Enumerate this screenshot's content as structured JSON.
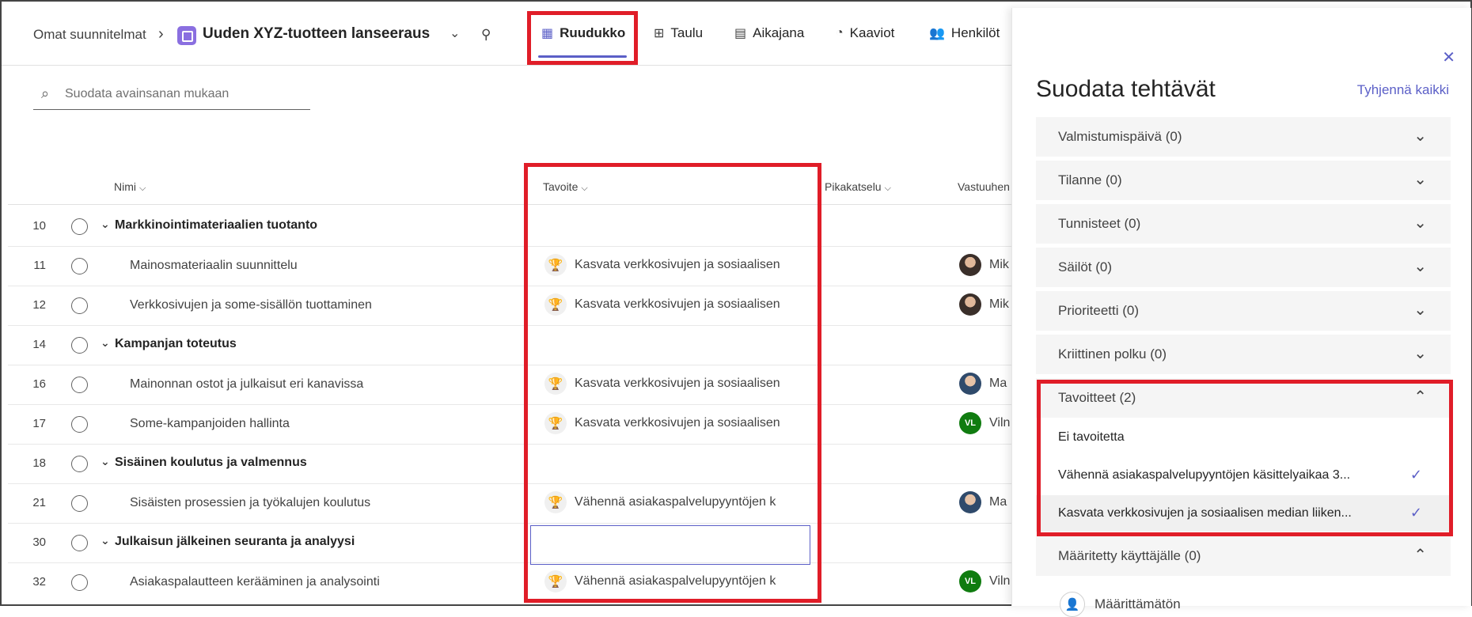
{
  "header": {
    "breadcrumb_root": "Omat suunnitelmat",
    "plan_title": "Uuden XYZ-tuotteen lanseeraus",
    "tabs": [
      {
        "label": "Ruudukko",
        "icon": "grid-icon"
      },
      {
        "label": "Taulu",
        "icon": "board-icon"
      },
      {
        "label": "Aikajana",
        "icon": "timeline-icon"
      },
      {
        "label": "Kaaviot",
        "icon": "charts-icon"
      },
      {
        "label": "Henkilöt",
        "icon": "people-icon"
      }
    ],
    "active_tab": "Ruudukko"
  },
  "search": {
    "placeholder": "Suodata avainsanan mukaan"
  },
  "columns": {
    "name": "Nimi",
    "goal": "Tavoite",
    "quickview": "Pikakatselu",
    "assignee": "Vastuuhen"
  },
  "rows": [
    {
      "num": "10",
      "name": "Markkinointimateriaalien tuotanto",
      "group": true
    },
    {
      "num": "11",
      "name": "Mainosmateriaalin suunnittelu",
      "goal": "Kasvata verkkosivujen ja sosiaalisen",
      "assignee": "Mik"
    },
    {
      "num": "12",
      "name": "Verkkosivujen ja some-sisällön tuottaminen",
      "goal": "Kasvata verkkosivujen ja sosiaalisen",
      "assignee": "Mik"
    },
    {
      "num": "14",
      "name": "Kampanjan toteutus",
      "group": true
    },
    {
      "num": "16",
      "name": "Mainonnan ostot ja julkaisut eri kanavissa",
      "goal": "Kasvata verkkosivujen ja sosiaalisen",
      "assignee": "Ma"
    },
    {
      "num": "17",
      "name": "Some-kampanjoiden hallinta",
      "goal": "Kasvata verkkosivujen ja sosiaalisen",
      "assignee": "Viln",
      "initials": "VL"
    },
    {
      "num": "18",
      "name": "Sisäinen koulutus ja valmennus",
      "group": true
    },
    {
      "num": "21",
      "name": "Sisäisten prosessien ja työkalujen koulutus",
      "goal": "Vähennä asiakaspalvelupyyntöjen k",
      "assignee": "Ma"
    },
    {
      "num": "30",
      "name": "Julkaisun jälkeinen seuranta ja analyysi",
      "group": true
    },
    {
      "num": "32",
      "name": "Asiakaspalautteen kerääminen ja analysointi",
      "goal": "Vähennä asiakaspalvelupyyntöjen k",
      "assignee": "Viln",
      "initials": "VL"
    }
  ],
  "panel": {
    "title": "Suodata tehtävät",
    "clear_all": "Tyhjennä kaikki",
    "sections": [
      "Valmistumispäivä (0)",
      "Tilanne (0)",
      "Tunnisteet (0)",
      "Säilöt (0)",
      "Prioriteetti (0)",
      "Kriittinen polku (0)",
      "Tavoitteet (2)",
      "Määritetty käyttäjälle (0)"
    ],
    "goal_options": [
      "Ei tavoitetta",
      "Vähennä asiakaspalvelupyyntöjen käsittelyaikaa 3...",
      "Kasvata verkkosivujen ja sosiaalisen median liiken..."
    ],
    "unassigned": "Määrittämätön"
  },
  "colors": {
    "accent": "#5b5fc7",
    "highlight": "#e01d28",
    "vl_avatar": "#107c10"
  }
}
